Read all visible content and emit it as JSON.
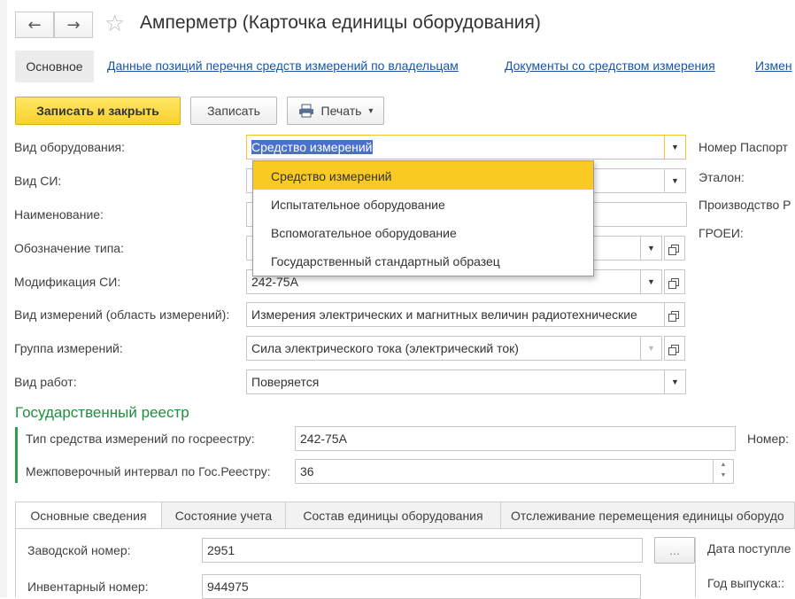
{
  "window": {
    "title": "Амперметр (Карточка единицы оборудования)",
    "nav": {
      "back_icon": "←",
      "forward_icon": "→",
      "star_icon": "☆"
    }
  },
  "header_tabs": {
    "active": "Основное",
    "links": [
      "Данные позиций перечня средств измерений по владельцам",
      "Документы со средством измерения",
      "Измен"
    ]
  },
  "toolbar": {
    "save_close": "Записать и закрыть",
    "save": "Записать",
    "print": "Печать",
    "print_arrow": "▾",
    "print_icon": "printer-icon"
  },
  "form": {
    "equipment_type": {
      "label": "Вид оборудования:",
      "value": "Средство измерений"
    },
    "si_type": {
      "label": "Вид СИ:",
      "value": ""
    },
    "name": {
      "label": "Наименование:",
      "value": ""
    },
    "type_designation": {
      "label": "Обозначение типа:",
      "value": ""
    },
    "modification": {
      "label": "Модификация СИ:",
      "value": "242-75А"
    },
    "measurement_kind": {
      "label": "Вид измерений (область измерений):",
      "value": "Измерения электрических и магнитных величин радиотехнические"
    },
    "measurement_group": {
      "label": "Группа измерений:",
      "value": "Сила электрического тока (электрический ток)"
    },
    "work_type": {
      "label": "Вид работ:",
      "value": "Поверяется"
    }
  },
  "right_labels": {
    "passport": "Номер Паспорт",
    "etalon": "Эталон:",
    "manufacturer": "Производство Р",
    "groei": "ГРОЕИ:"
  },
  "dropdown": {
    "options": [
      "Средство измерений",
      "Испытательное оборудование",
      "Вспомогательное оборудование",
      "Государственный стандартный образец"
    ],
    "selected_index": 0
  },
  "registry": {
    "title": "Государственный реестр",
    "type_label": "Тип средства измерений по госреестру:",
    "type_value": "242-75А",
    "interval_label": "Межповерочный интервал по Гос.Реестру:",
    "interval_value": "36",
    "number_label": "Номер:"
  },
  "subtabs": [
    "Основные сведения",
    "Состояние учета",
    "Состав единицы оборудования",
    "Отслеживание перемещения единицы оборудо"
  ],
  "details": {
    "serial_label": "Заводской номер:",
    "serial_value": "2951",
    "inventory_label": "Инвентарный номер:",
    "inventory_value": "944975",
    "ellipsis": "...",
    "arrival_label": "Дата поступле",
    "year_label": "Год выпуска::"
  },
  "colors": {
    "accent_yellow": "#f9ca21",
    "link_blue": "#1a55a5",
    "section_green": "#1e8f3c",
    "selection_blue": "#4a6fcf"
  }
}
